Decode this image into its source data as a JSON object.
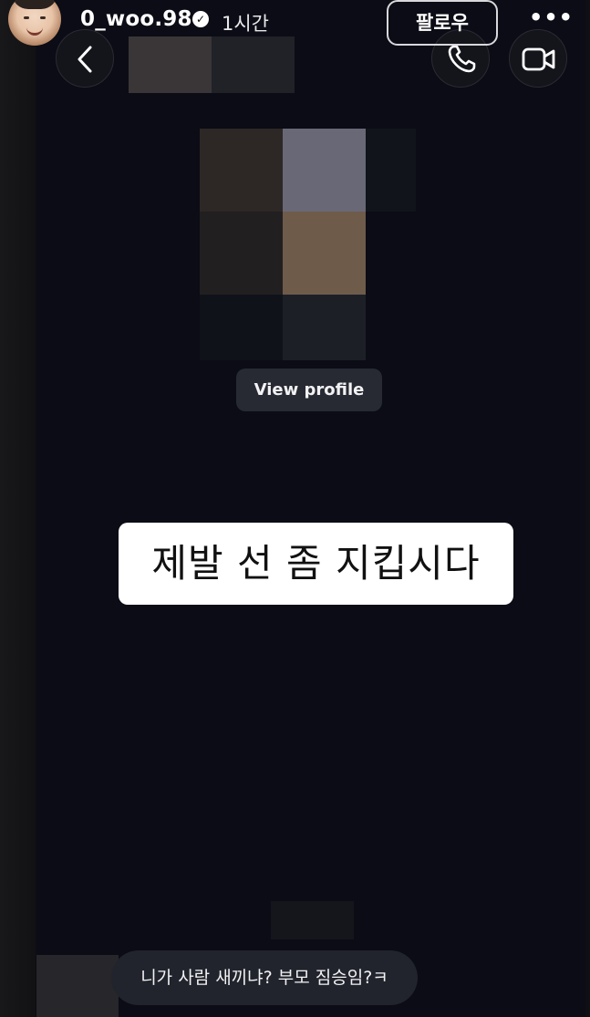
{
  "story": {
    "username": "0_woo.98",
    "time_ago": "1시간",
    "follow_label": "팔로우",
    "more_label": "•••"
  },
  "dm": {
    "view_profile_label": "View profile",
    "caption": "제발 선 좀 지킵시다",
    "message": "니가 사람 새끼냐? 부모 짐승임?ㅋ"
  },
  "icons": {
    "back": "chevron-left-icon",
    "call": "phone-icon",
    "video": "video-camera-icon",
    "verified": "verified-badge-icon"
  },
  "colors": {
    "background": "#0b0c15",
    "button": "#272a33",
    "bubble": "#22242d",
    "caption_bg": "#ffffff"
  }
}
